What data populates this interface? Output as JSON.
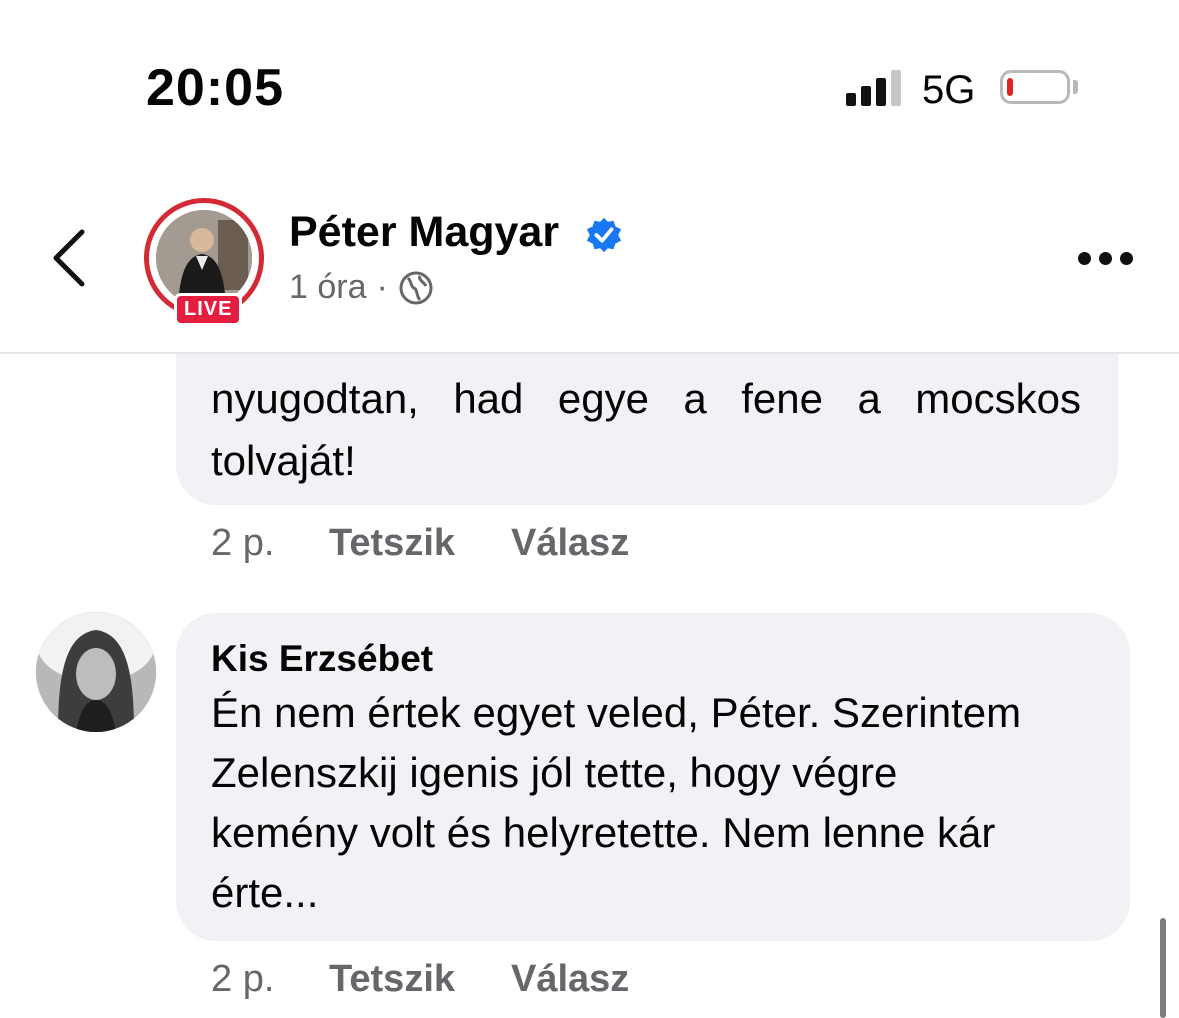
{
  "status_bar": {
    "time": "20:05",
    "network": "5G",
    "battery_level": 0.05,
    "battery_color": "#e02424"
  },
  "header": {
    "page_name": "Péter Magyar",
    "time_ago": "1 óra",
    "separator": "·",
    "live_label": "LIVE",
    "icons": [
      "back-icon",
      "verified-icon",
      "globe-icon",
      "more-icon"
    ],
    "accent_color": "#1877f2",
    "live_color": "#e41e3f"
  },
  "comments": [
    {
      "text_line1": "nyugodtan, had egye a fene a mocskos",
      "text_line2": "tolvaját!",
      "time": "2 p.",
      "like_label": "Tetszik",
      "reply_label": "Válasz"
    },
    {
      "author": "Kis Erzsébet",
      "text": "Én nem értek egyet veled, Péter. Szerintem\nZelenszkij igenis jól tette, hogy végre\nkemény volt és helyretette. Nem lenne kár\nérte...",
      "time": "2 p.",
      "like_label": "Tetszik",
      "reply_label": "Válasz"
    }
  ]
}
